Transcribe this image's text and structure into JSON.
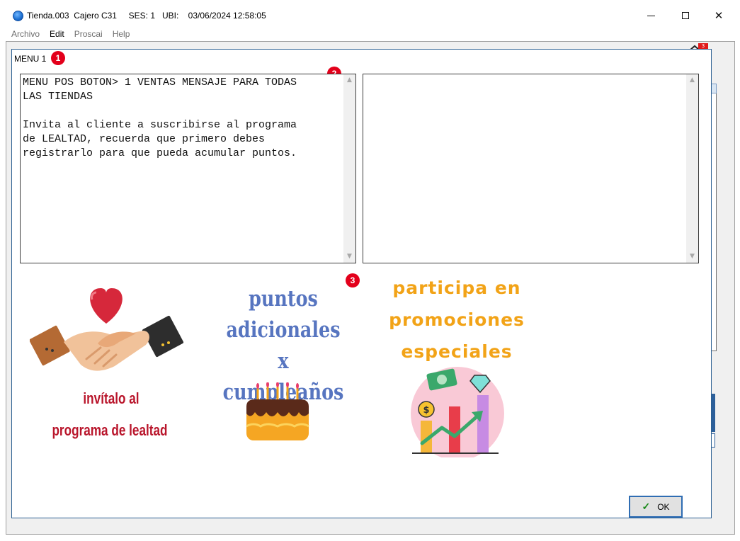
{
  "window": {
    "title": "Tienda.003  Cajero C31     SES: 1   UBI:    03/06/2024 12:58:05",
    "controls": {
      "minimize": "minimize",
      "maximize": "maximize",
      "close": "✕"
    }
  },
  "menubar": {
    "items": [
      {
        "label": "Archivo",
        "active": false
      },
      {
        "label": "Edit",
        "active": true
      },
      {
        "label": "Proscai",
        "active": false
      },
      {
        "label": "Help",
        "active": false
      }
    ]
  },
  "background": {
    "badge": "3"
  },
  "dialog": {
    "title": "MENU 1",
    "markers": [
      "1",
      "2",
      "3"
    ],
    "left_text": "MENU POS BOTON> 1 VENTAS MENSAJE PARA TODAS\nLAS TIENDAS\n\nInvita al cliente a suscribirse al programa\nde LEALTAD, recuerda que primero debes\nregistrarlo para que pueda acumular puntos.",
    "right_text": "",
    "promo": {
      "panel1_line1": "invítalo al",
      "panel1_line2": "programa de lealtad",
      "panel2": "puntos\nadicionales\nx cumpleaños",
      "panel3": "participa en\npromociones\nespeciales"
    },
    "ok_label": "OK"
  },
  "colors": {
    "accent": "#2f6db3",
    "marker": "#e3001b",
    "promo_red": "#b9152b",
    "promo_blue": "#5775c0",
    "promo_orange": "#f2a317"
  }
}
